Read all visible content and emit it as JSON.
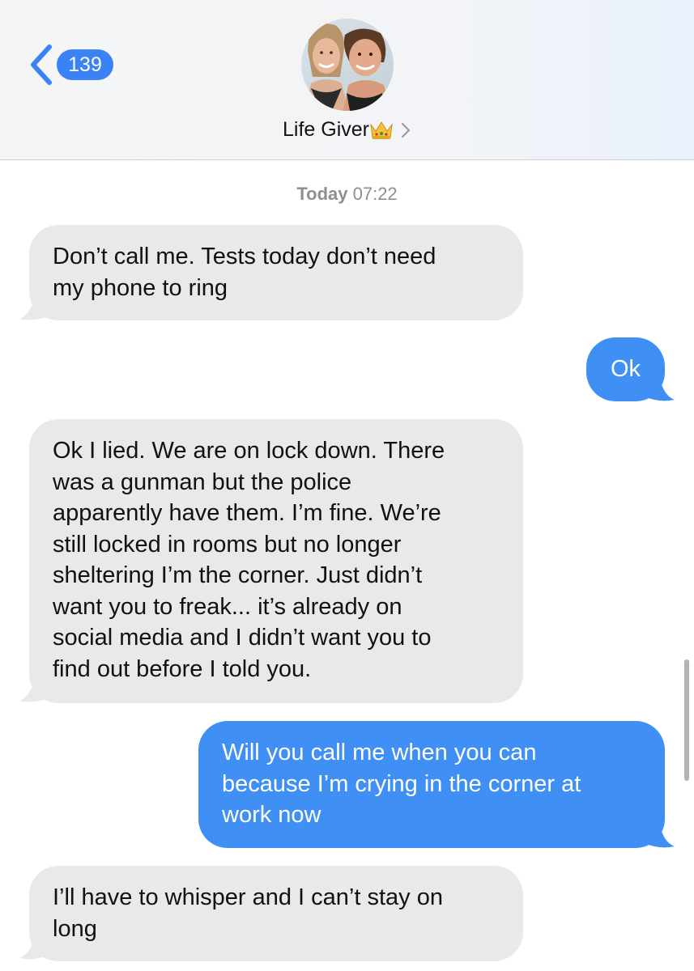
{
  "header": {
    "back_badge_count": "139",
    "contact_name": "Life Giver",
    "contact_emoji_icon": "crown-icon",
    "accent_color": "#3b82f6"
  },
  "thread": {
    "timestamp_day": "Today",
    "timestamp_time": "07:22"
  },
  "messages": [
    {
      "direction": "incoming",
      "lines": [
        "Don’t call me. Tests today don’t need",
        "my phone to ring"
      ]
    },
    {
      "direction": "outgoing",
      "lines": [
        "Ok"
      ]
    },
    {
      "direction": "incoming",
      "lines": [
        "Ok I lied. We are on lock down. There",
        "was a gunman but the police",
        "apparently have them. I’m fine. We’re",
        "still locked in rooms but no longer",
        "sheltering I’m the corner. Just didn’t",
        "want you to freak... it’s already on",
        "social media and I didn’t want you to",
        "find out before I told you."
      ]
    },
    {
      "direction": "outgoing",
      "lines": [
        "Will you call me when you can",
        "because I’m crying in the corner at",
        "work now"
      ]
    },
    {
      "direction": "incoming",
      "lines": [
        "I’ll have to whisper and I can’t stay on",
        "long"
      ]
    }
  ],
  "colors": {
    "incoming_bubble": "#e9e9eb",
    "outgoing_bubble": "#3f8ff5",
    "timestamp_text": "#8e8e93"
  }
}
